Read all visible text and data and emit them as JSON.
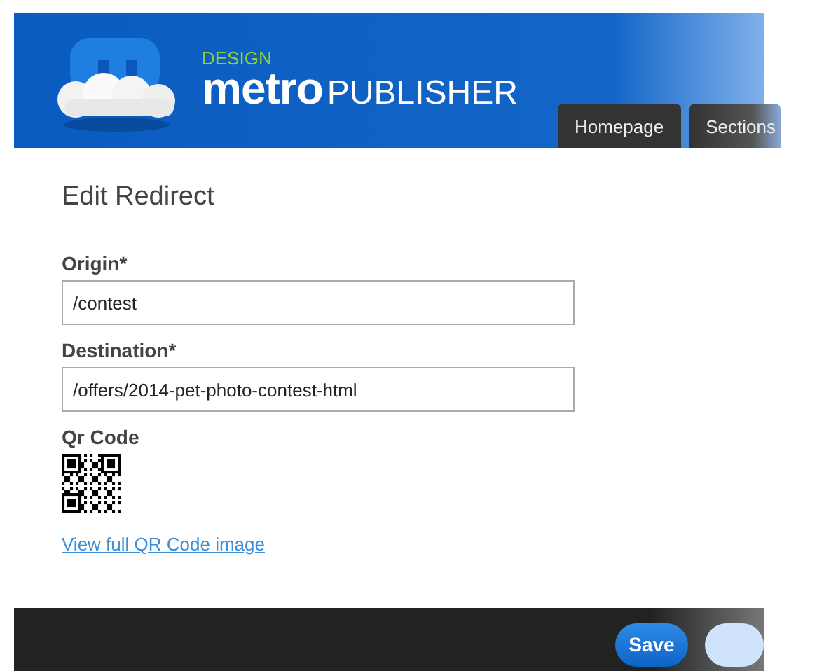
{
  "header": {
    "tagline": "DESIGN",
    "brand_bold": "metro",
    "brand_light": "PUBLISHER"
  },
  "tabs": [
    {
      "label": "Homepage",
      "selected": false
    },
    {
      "label": "Sections",
      "selected": false
    }
  ],
  "form": {
    "title": "Edit Redirect",
    "fields": [
      {
        "label": "Origin*",
        "value": "/contest"
      },
      {
        "label": "Destination*",
        "value": "/offers/2014-pet-photo-contest-html"
      }
    ],
    "qr": {
      "label": "Qr Code",
      "link": "View full QR Code image"
    }
  },
  "footer": {
    "buttons": [
      {
        "label": "Save",
        "kind": "primary"
      },
      {
        "kind": "faded"
      }
    ]
  }
}
